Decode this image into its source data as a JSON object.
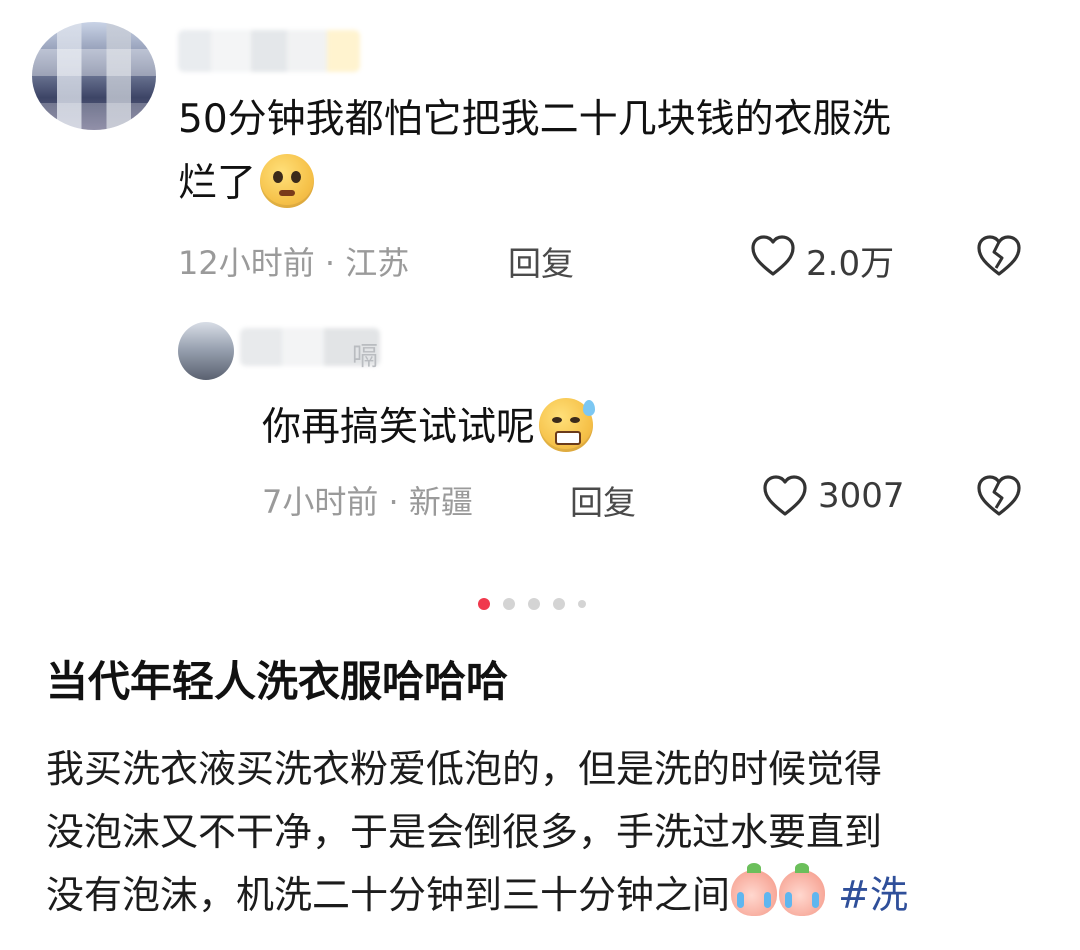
{
  "comment": {
    "text_line1": "50分钟我都怕它把我二十几块钱的衣服洗",
    "text_line2": "烂了",
    "time_location": "12小时前 · 江苏",
    "reply_label": "回复",
    "likes": "2.0万",
    "emoji": "pleading-face"
  },
  "reply": {
    "text": "你再搞笑试试呢",
    "name_tail": "嗝",
    "time_location": "7小时前 · 新疆",
    "reply_label": "回复",
    "likes": "3007",
    "emoji": "grinning-sweat-face"
  },
  "pager": {
    "count": 5,
    "active_index": 0,
    "active_color": "#f0394d"
  },
  "post": {
    "title": "当代年轻人洗衣服哈哈哈",
    "body_line1": "我买洗衣液买洗衣粉爱低泡的，但是洗的时候觉得",
    "body_line2": "没泡沫又不干净，于是会倒很多，手洗过水要直到",
    "body_line3": "没有泡沫，机洗二十分钟到三十分钟之间",
    "hashtag": "#洗",
    "emojis": [
      "crying-peach-icon",
      "crying-peach-icon"
    ]
  },
  "icons": {
    "like": "heart-outline-icon",
    "dislike": "broken-heart-icon"
  }
}
